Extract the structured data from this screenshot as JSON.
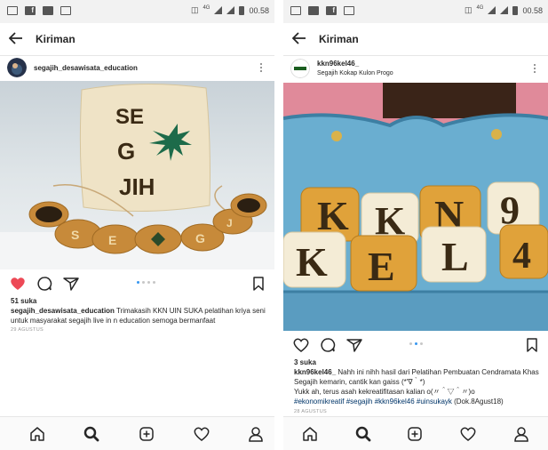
{
  "status_bar": {
    "time_left": "00.58",
    "time_right": "00.58",
    "net": "4G"
  },
  "left": {
    "topbar_title": "Kiriman",
    "username": "segajih_desawisata_education",
    "likes": "51 suka",
    "caption_user": "segajih_desawisata_education",
    "caption_text": " Trimakasih KKN UIN SUKA pelatihan kriya seni untuk masyarakat segajih live in n education semoga bermanfaat",
    "date": "29 AGUSTUS",
    "pillow_letters": [
      "SE",
      "G",
      "JIH"
    ],
    "coaster_letters": [
      "S",
      "E",
      "G",
      "J"
    ],
    "liked": true
  },
  "right": {
    "topbar_title": "Kiriman",
    "username": "kkn96kel46_",
    "location": "Segajih Kokap Kulon Progo",
    "likes": "3 suka",
    "caption_user": "kkn96kel46_",
    "caption_line1": " Nahh ini nihh hasil dari Pelatihan Pembuatan Cendramata Khas Segajih kemarin, cantik kan gaiss (*'∇｀*)",
    "caption_line2": "Yukk ah, terus asah kekreatifitasan kalian o(〃＾▽＾〃)o",
    "hashtags": "#ekonomikreatif #segajih #kkn96kel46 #uinsukayk",
    "hashtag_suffix": " (Dok.8Agust18)",
    "date": "28 AGUSTUS",
    "pillow_letters": [
      "K",
      "K",
      "N",
      "9",
      "K",
      "E",
      "L",
      "4"
    ],
    "liked": false
  },
  "colors": {
    "like_red": "#ed4956",
    "blue_dot": "#3897f0",
    "hashtag": "#003569",
    "sofa_blue": "#6aaed0",
    "pink_wall": "#e08a9a"
  }
}
